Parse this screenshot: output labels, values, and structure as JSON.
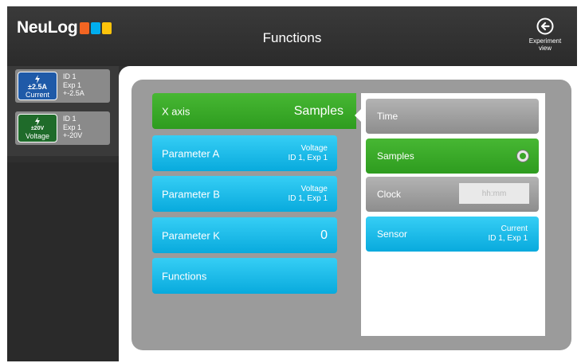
{
  "app": {
    "logo_text": "NeuLog",
    "logo_colors": [
      "#f26522",
      "#00aeef",
      "#fcc30b"
    ]
  },
  "header": {
    "title": "Functions",
    "experiment_view_label": "Experiment view",
    "experiment_icon": "back-arrow-circle-icon"
  },
  "sensors": [
    {
      "range": "±2.5A",
      "type": "Current",
      "id": "ID 1",
      "exp": "Exp 1",
      "range_info": "+-2.5A",
      "color": "#1f5aa8"
    },
    {
      "range": "±20V",
      "type": "Voltage",
      "id": "ID 1",
      "exp": "Exp 1",
      "range_info": "+-20V",
      "color": "#1f6b2a"
    }
  ],
  "menu": {
    "x_axis": {
      "label": "X axis",
      "value": "Samples"
    },
    "param_a": {
      "label": "Parameter A",
      "value_line1": "Voltage",
      "value_line2": "ID 1, Exp 1"
    },
    "param_b": {
      "label": "Parameter B",
      "value_line1": "Voltage",
      "value_line2": "ID 1, Exp 1"
    },
    "param_k": {
      "label": "Parameter K",
      "value": "0"
    },
    "functions": {
      "label": "Functions"
    }
  },
  "submenu": {
    "time": {
      "label": "Time"
    },
    "samples": {
      "label": "Samples",
      "selected": true
    },
    "clock": {
      "label": "Clock",
      "placeholder": "hh:mm"
    },
    "sensor": {
      "label": "Sensor",
      "value_line1": "Current",
      "value_line2": "ID 1, Exp 1"
    }
  },
  "colors": {
    "accent_blue": "#08aadd",
    "accent_green": "#2e9c1f",
    "dark_bg": "#2f2f2f"
  }
}
